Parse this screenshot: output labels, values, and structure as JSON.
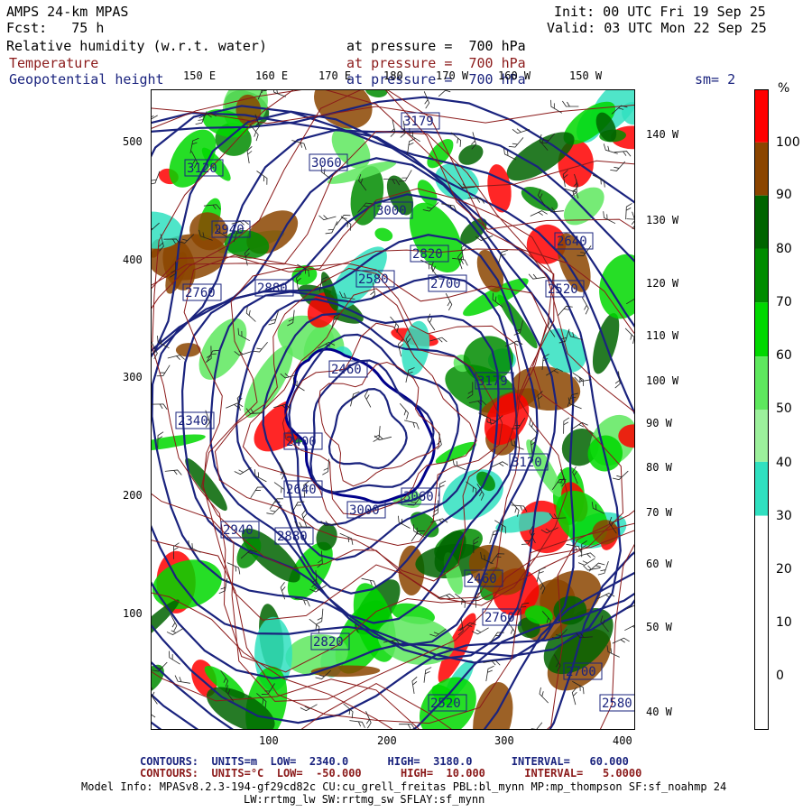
{
  "header": {
    "model": "AMPS 24-km MPAS",
    "fcst": "Fcst:   75 h",
    "init": "Init: 00 UTC Fri 19 Sep 25",
    "valid": "Valid: 03 UTC Mon 22 Sep 25"
  },
  "fields": [
    {
      "name": "Relative humidity (w.r.t. water)",
      "level": "at pressure =  700 hPa",
      "color": "#000000"
    },
    {
      "name": "Temperature",
      "level": "at pressure =  700 hPa",
      "color": "#8b1a1a"
    },
    {
      "name": "Geopotential height",
      "level": "at pressure =  700 hPa",
      "color": "#1a237e"
    }
  ],
  "smoothing": "sm= 2",
  "top_lon_labels": [
    "150 E",
    "160 E",
    "170 E",
    "180",
    "170 W",
    "160 W",
    "150 W"
  ],
  "right_lon_labels": [
    "140 W",
    "130 W",
    "120 W",
    "110 W",
    "100 W",
    "90 W",
    "80 W",
    "70 W",
    "60 W",
    "50 W",
    "40 W"
  ],
  "y_ticks": [
    "500",
    "400",
    "300",
    "200",
    "100"
  ],
  "x_ticks": [
    "100",
    "200",
    "300",
    "400"
  ],
  "colorbar": {
    "unit": "%",
    "labels": [
      "100",
      "90",
      "80",
      "70",
      "60",
      "50",
      "40",
      "30",
      "20",
      "10",
      "0"
    ],
    "bands": [
      {
        "from": 100,
        "color": "#ff0000"
      },
      {
        "from": 90,
        "color": "#8b4500"
      },
      {
        "from": 80,
        "color": "#006400"
      },
      {
        "from": 70,
        "color": "#008c00"
      },
      {
        "from": 60,
        "color": "#00d800"
      },
      {
        "from": 50,
        "color": "#5ee85e"
      },
      {
        "from": 40,
        "color": "#9cf09c"
      },
      {
        "from": 30,
        "color": "#30e0c0"
      },
      {
        "from": 0,
        "color": "#ffffff"
      }
    ]
  },
  "height_labels": [
    "3179",
    "3120",
    "3060",
    "3000",
    "2940",
    "2880",
    "2820",
    "2760",
    "2700",
    "2640",
    "2580",
    "2520",
    "2460",
    "2400",
    "2340"
  ],
  "footer": {
    "line1_a": "CONTOURS:  UNITS=m  LOW=  2340.0      HIGH=  3180.0      INTERVAL=   60.000",
    "line1_b": "CONTOURS:  UNITS=°C  LOW=  -50.000      HIGH=  10.000      INTERVAL=   5.0000",
    "line2": "Model Info: MPASv8.2.3-194-gf29cd82c CU:cu_grell_freitas PBL:bl_mynn MP:mp_thompson SF:sf_noahmp 24",
    "line3": "LW:rrtmg_lw SW:rrtmg_sw SFLAY:sf_mynn"
  }
}
